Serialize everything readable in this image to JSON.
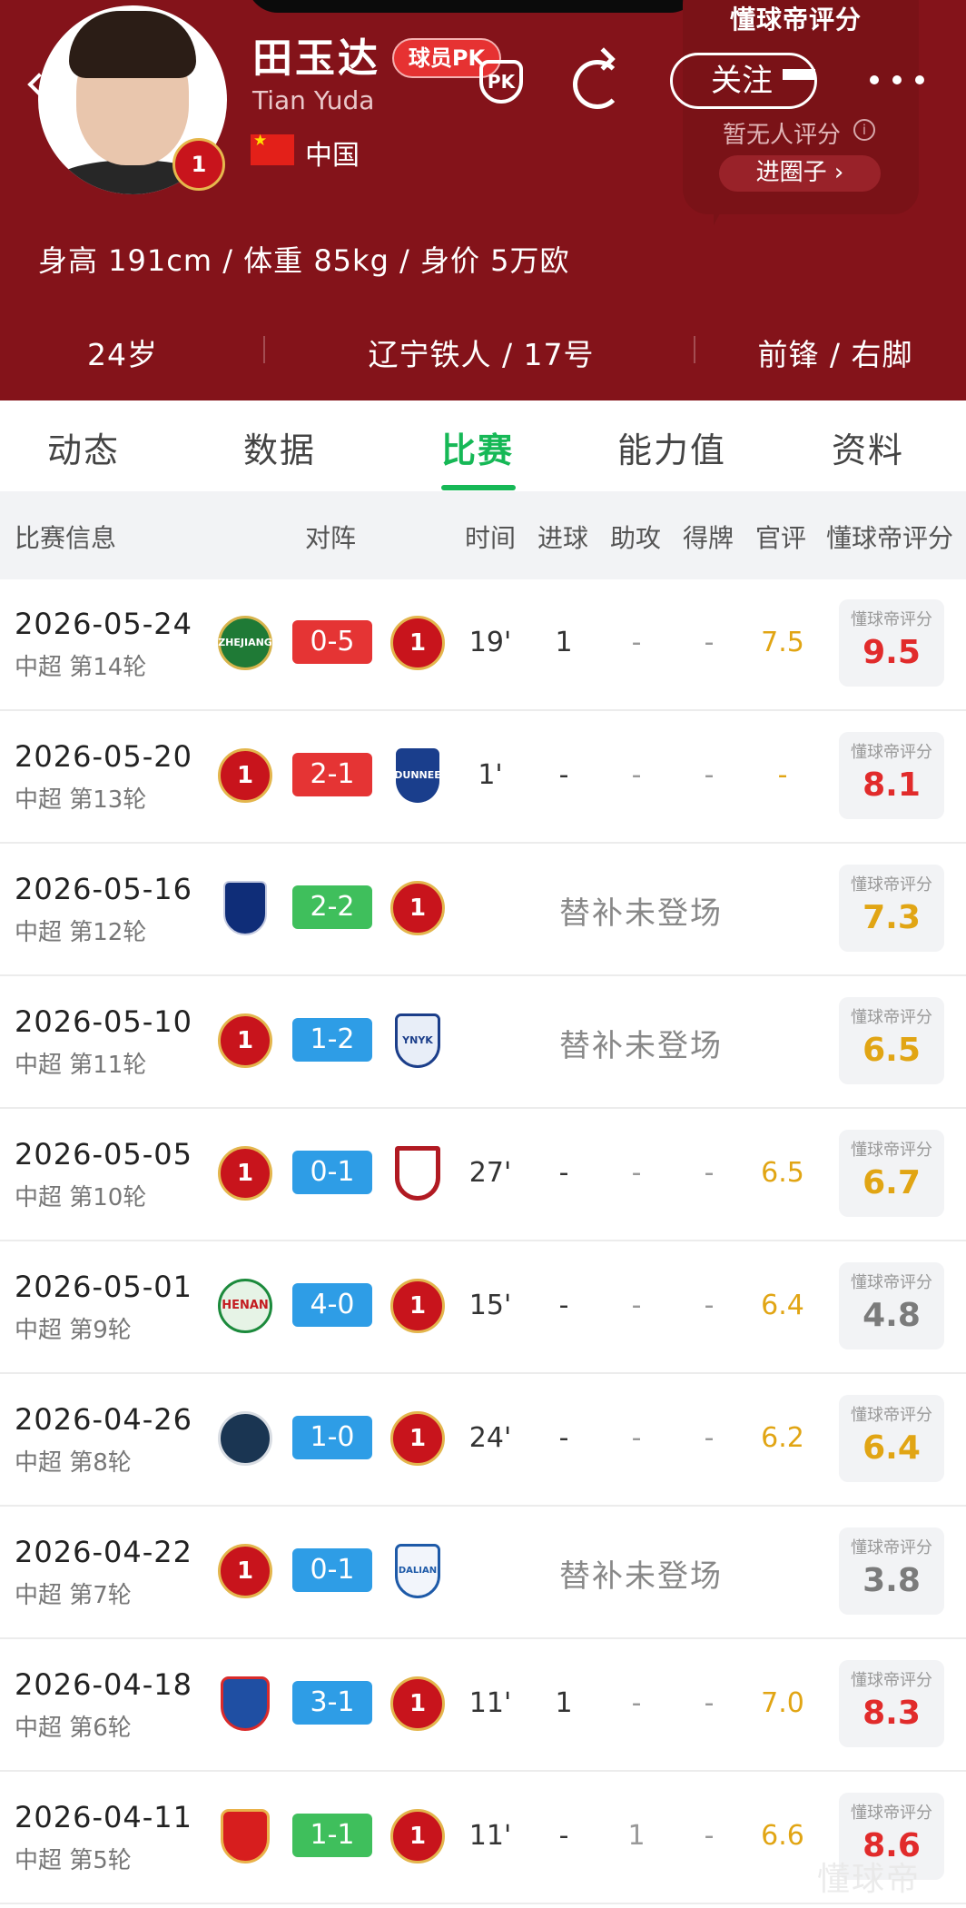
{
  "player": {
    "name": "田玉达",
    "name_en": "Tian Yuda",
    "pk_label": "球员PK",
    "country": "中国",
    "stats_line": "身高 191cm / 体重 85kg / 身价 5万欧",
    "age": "24岁",
    "club_number": "辽宁铁人 / 17号",
    "position_foot": "前锋 / 右脚"
  },
  "header": {
    "follow_label": "关注",
    "rating_popup": {
      "title": "懂球帝评分",
      "subtitle": "暂无人评分",
      "button": "进圈子 ›"
    }
  },
  "tabs": [
    {
      "label": "动态",
      "active": false
    },
    {
      "label": "数据",
      "active": false
    },
    {
      "label": "比赛",
      "active": true
    },
    {
      "label": "能力值",
      "active": false
    },
    {
      "label": "资料",
      "active": false
    }
  ],
  "columns": {
    "info": "比赛信息",
    "matchup": "对阵",
    "time": "时间",
    "goals": "进球",
    "assists": "助攻",
    "cards": "得牌",
    "official": "官评",
    "dqd": "懂球帝评分"
  },
  "rating_label": "懂球帝评分",
  "matches": [
    {
      "date": "2026-05-24",
      "round": "中超 第14轮",
      "home": "ZHEJIANG",
      "score": "0-5",
      "away": "1",
      "minutes": "19'",
      "goals": "1",
      "assists": "-",
      "cards": "-",
      "official": "7.5",
      "note": "",
      "rating": "9.5",
      "score_type": "loss",
      "rating_color": "red"
    },
    {
      "date": "2026-05-20",
      "round": "中超 第13轮",
      "home": "1",
      "score": "2-1",
      "away": "DUNNEE",
      "minutes": "1'",
      "goals": "-",
      "assists": "-",
      "cards": "-",
      "official": "-",
      "note": "",
      "rating": "8.1",
      "score_type": "loss",
      "rating_color": "red"
    },
    {
      "date": "2026-05-16",
      "round": "中超 第12轮",
      "home": "",
      "score": "2-2",
      "away": "1",
      "minutes": "",
      "goals": "",
      "assists": "",
      "cards": "",
      "official": "",
      "note": "替补未登场",
      "rating": "7.3",
      "score_type": "draw",
      "rating_color": "orange"
    },
    {
      "date": "2026-05-10",
      "round": "中超 第11轮",
      "home": "1",
      "score": "1-2",
      "away": "YNYK",
      "minutes": "",
      "goals": "",
      "assists": "",
      "cards": "",
      "official": "",
      "note": "替补未登场",
      "rating": "6.5",
      "score_type": "win",
      "rating_color": "orange"
    },
    {
      "date": "2026-05-05",
      "round": "中超 第10轮",
      "home": "1",
      "score": "0-1",
      "away": "",
      "minutes": "27'",
      "goals": "-",
      "assists": "-",
      "cards": "-",
      "official": "6.5",
      "note": "",
      "rating": "6.7",
      "score_type": "win",
      "rating_color": "orange"
    },
    {
      "date": "2026-05-01",
      "round": "中超 第9轮",
      "home": "HENAN",
      "score": "4-0",
      "away": "1",
      "minutes": "15'",
      "goals": "-",
      "assists": "-",
      "cards": "-",
      "official": "6.4",
      "note": "",
      "rating": "4.8",
      "score_type": "win",
      "rating_color": "gray"
    },
    {
      "date": "2026-04-26",
      "round": "中超 第8轮",
      "home": "",
      "score": "1-0",
      "away": "1",
      "minutes": "24'",
      "goals": "-",
      "assists": "-",
      "cards": "-",
      "official": "6.2",
      "note": "",
      "rating": "6.4",
      "score_type": "win",
      "rating_color": "orange"
    },
    {
      "date": "2026-04-22",
      "round": "中超 第7轮",
      "home": "1",
      "score": "0-1",
      "away": "DALIAN",
      "minutes": "",
      "goals": "",
      "assists": "",
      "cards": "",
      "official": "",
      "note": "替补未登场",
      "rating": "3.8",
      "score_type": "win",
      "rating_color": "gray"
    },
    {
      "date": "2026-04-18",
      "round": "中超 第6轮",
      "home": "",
      "score": "3-1",
      "away": "1",
      "minutes": "11'",
      "goals": "1",
      "assists": "-",
      "cards": "-",
      "official": "7.0",
      "note": "",
      "rating": "8.3",
      "score_type": "win",
      "rating_color": "red"
    },
    {
      "date": "2026-04-11",
      "round": "中超 第5轮",
      "home": "",
      "score": "1-1",
      "away": "1",
      "minutes": "11'",
      "goals": "-",
      "assists": "1",
      "cards": "-",
      "official": "6.6",
      "note": "",
      "rating": "8.6",
      "score_type": "draw",
      "rating_color": "red"
    }
  ],
  "watermark": "懂球帝",
  "colors": {
    "header_bg": "#84131a",
    "accent_green": "#16b856",
    "score_red": "#e53434",
    "score_blue": "#2e9de6",
    "score_green": "#3fbf5c",
    "rating_red": "#e12b2b",
    "rating_orange": "#e1a514"
  },
  "icons": [
    "back-chevron-icon",
    "pk-icon",
    "share-icon",
    "more-icon",
    "info-icon",
    "china-flag-icon"
  ]
}
